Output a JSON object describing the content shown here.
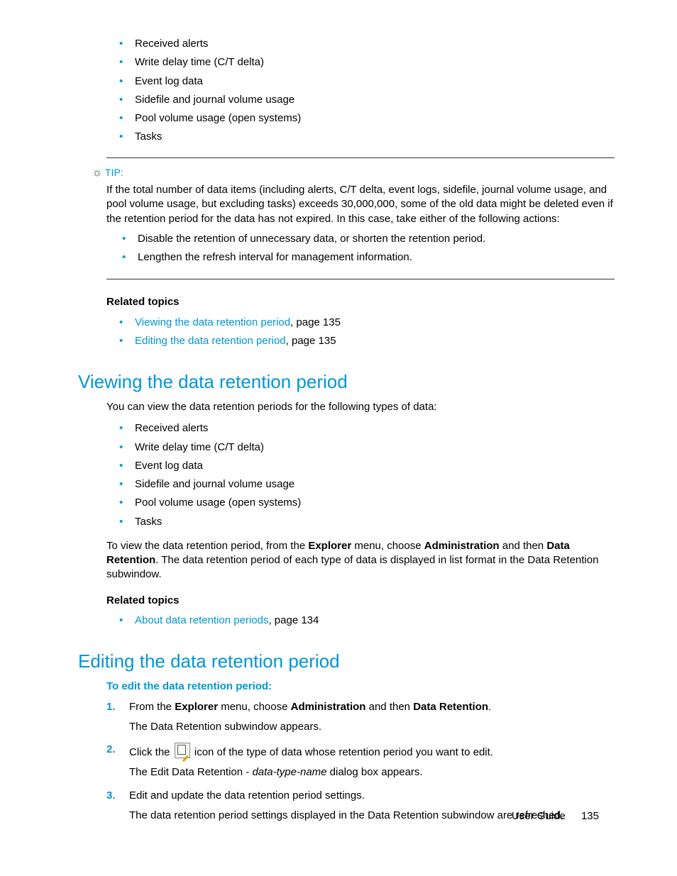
{
  "list1": {
    "i0": "Received alerts",
    "i1": "Write delay time (C/T delta)",
    "i2": "Event log data",
    "i3": "Sidefile and journal volume usage",
    "i4": "Pool volume usage (open systems)",
    "i5": "Tasks"
  },
  "tip": {
    "label": "TIP:",
    "text": "If the total number of data items (including alerts, C/T delta, event logs, sidefile, journal volume usage, and pool volume usage, but excluding tasks) exceeds 30,000,000, some of the old data might be deleted even if the retention period for the data has not expired. In this case, take either of the following actions:",
    "a0": "Disable the retention of unnecessary data, or shorten the retention period.",
    "a1": "Lengthen the refresh interval for management information."
  },
  "related1": {
    "heading": "Related topics",
    "l0": "Viewing the data retention period",
    "p0": ", page 135",
    "l1": "Editing the data retention period",
    "p1": ", page 135"
  },
  "sec1": {
    "title": "Viewing the data retention period",
    "intro": "You can view the data retention periods for the following types of data:",
    "list": {
      "i0": "Received alerts",
      "i1": "Write delay time (C/T delta)",
      "i2": "Event log data",
      "i3": "Sidefile and journal volume usage",
      "i4": "Pool volume usage (open systems)",
      "i5": "Tasks"
    },
    "para_a": "To view the data retention period, from the ",
    "para_b": "Explorer",
    "para_c": " menu, choose ",
    "para_d": "Administration",
    "para_e": " and then ",
    "para_f": "Data Retention",
    "para_g": ". The data retention period of each type of data is displayed in list format in the Data Retention subwindow.",
    "related_heading": "Related topics",
    "rlink": "About data retention periods",
    "rpage": ", page 134"
  },
  "sec2": {
    "title": "Editing the data retention period",
    "lead": "To edit the data retention period:",
    "s1a": "From the ",
    "s1b": "Explorer",
    "s1c": " menu, choose ",
    "s1d": "Administration",
    "s1e": " and then ",
    "s1f": "Data Retention",
    "s1g": ".",
    "s1sub": "The Data Retention subwindow appears.",
    "s2a": "Click the ",
    "s2b": " icon of the type of data whose retention period you want to edit.",
    "s2sub_a": "The Edit Data Retention - ",
    "s2sub_b": "data-type-name",
    "s2sub_c": " dialog box appears.",
    "s3": "Edit and update the data retention period settings.",
    "s3sub": "The data retention period settings displayed in the Data Retention subwindow are refreshed."
  },
  "footer": {
    "label": "User Guide",
    "page": "135"
  }
}
